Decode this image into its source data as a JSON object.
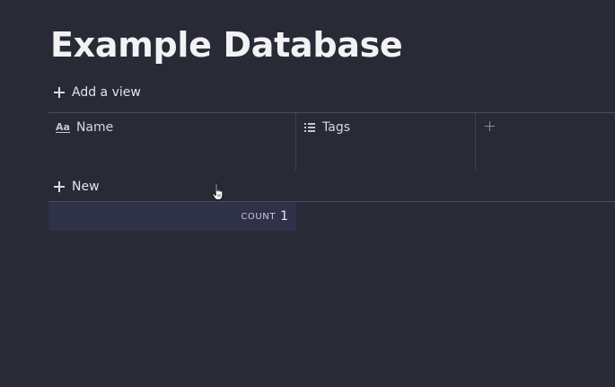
{
  "page": {
    "title": "Example Database"
  },
  "views": {
    "add_view_label": "Add a view"
  },
  "table": {
    "columns": [
      {
        "label": "Name",
        "icon": "text-property-icon"
      },
      {
        "label": "Tags",
        "icon": "list-icon"
      }
    ],
    "new_row_label": "New",
    "footer": {
      "count_label": "COUNT",
      "count_value": "1"
    }
  },
  "colors": {
    "background": "#282a36",
    "footer_background": "#30324a",
    "divider": "#4b4d5a",
    "text": "#e8e8ea"
  }
}
